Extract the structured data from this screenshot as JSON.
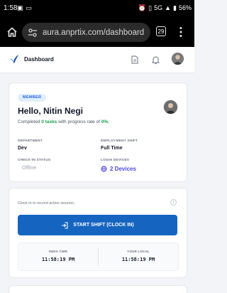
{
  "status_bar": {
    "time": "1:58",
    "network": "5G",
    "battery": "56%"
  },
  "browser": {
    "url": "aura.anprtix.com/dashboard",
    "tab_count": "29"
  },
  "nav": {
    "title": "Dashboard"
  },
  "profile": {
    "badge": "MEMBER",
    "greeting": "Hello, Nitin Negi",
    "summary_prefix": "Completed",
    "tasks": "0 tasks",
    "summary_middle": "with progress rate of",
    "rate": "0%.",
    "department_label": "DEPARTMENT",
    "department": "Dev",
    "shift_label": "EMPLOYMENT SHIFT",
    "shift": "Full Time",
    "checkin_label": "CHECK-IN STATUS",
    "checkin": "Offline",
    "devices_label": "LOGIN DEVICES",
    "devices": "2 Devices"
  },
  "clock": {
    "hint": "Clock in to record active session.",
    "button_label": "START SHIFT (CLOCK IN)",
    "india_label": "INDIA TIME",
    "india_time": "11:58:19 PM",
    "local_label": "YOUR LOCAL",
    "local_time": "11:58:19 PM"
  },
  "colors": {
    "accent": "#1565c0",
    "success": "#16a34a",
    "devices": "#4f46e5"
  }
}
